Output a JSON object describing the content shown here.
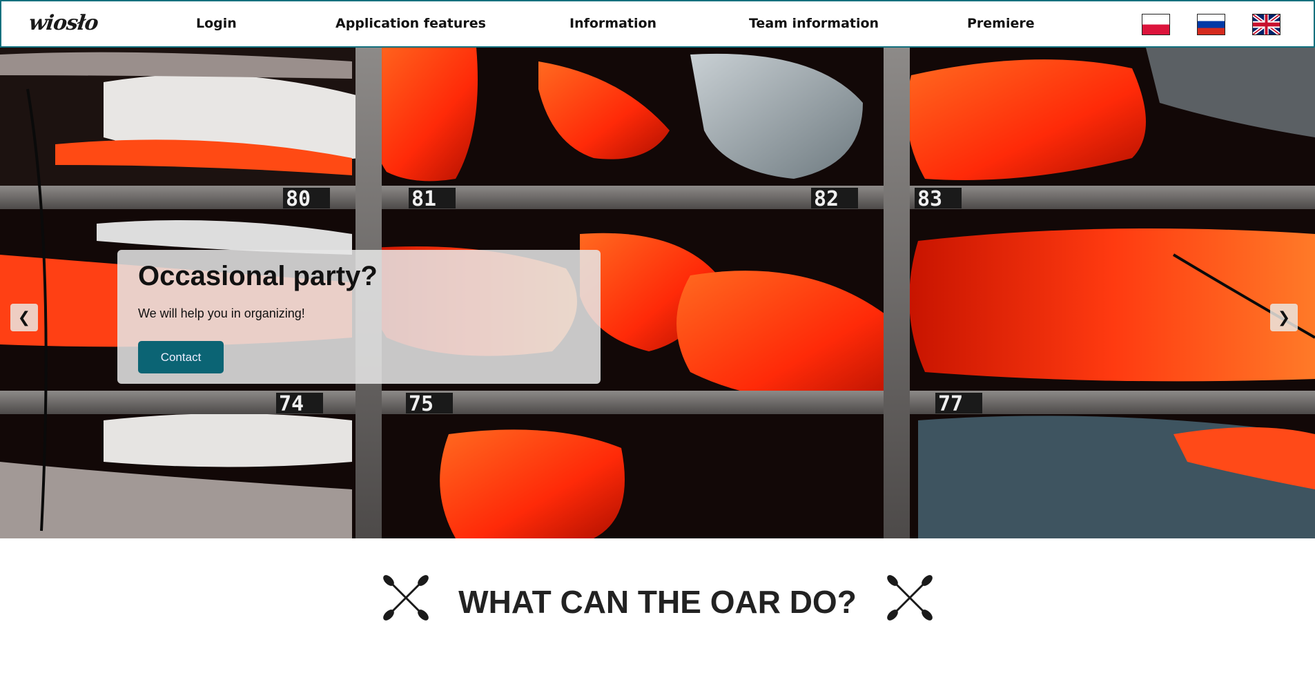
{
  "navbar": {
    "logo_text": "wiosło",
    "items": [
      {
        "label": "Login"
      },
      {
        "label": "Application features"
      },
      {
        "label": "Information"
      },
      {
        "label": "Team information"
      },
      {
        "label": "Premiere"
      }
    ],
    "flags": [
      "flag-pl-icon",
      "flag-ru-icon",
      "flag-uk-icon"
    ]
  },
  "hero": {
    "caption_title": "Occasional party?",
    "caption_text": "We will help you in organizing!",
    "button_label": "Contact",
    "prev_arrow": "❮",
    "next_arrow": "❯",
    "rack_numbers": [
      "80",
      "81",
      "82",
      "83",
      "74",
      "75",
      "77"
    ]
  },
  "section": {
    "title": "WHAT CAN THE OAR DO?"
  },
  "colors": {
    "accent": "#0b6474",
    "nav_border": "#12707e",
    "kayak_orange": "#ff3a10"
  }
}
